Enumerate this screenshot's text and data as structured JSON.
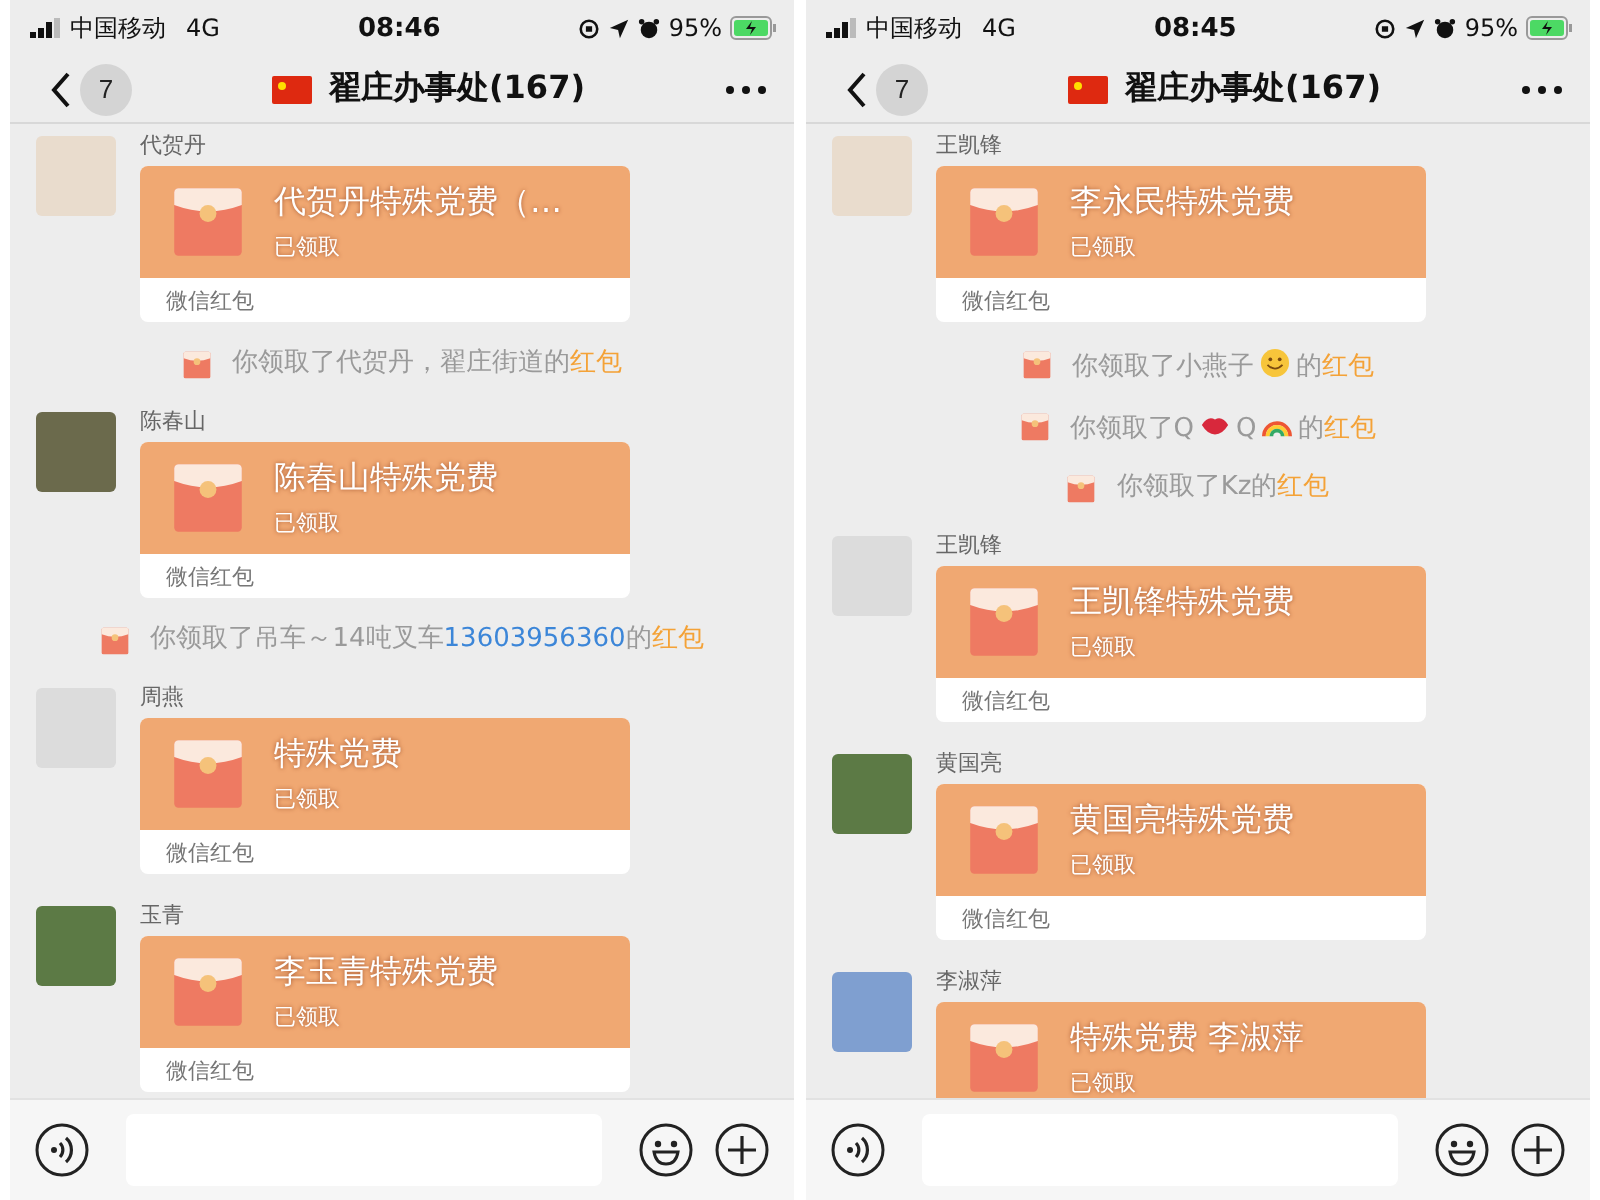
{
  "phones": [
    {
      "status_bar": {
        "carrier": "中国移动",
        "network": "4G",
        "time": "08:46",
        "battery": "95%"
      },
      "header": {
        "back_count": "7",
        "title": "翟庄办事处(167)"
      },
      "messages": [
        {
          "kind": "packet",
          "sender": "代贺丹",
          "title": "代贺丹特殊党费（…",
          "status": "已领取",
          "footer": "微信红包"
        },
        {
          "kind": "notice",
          "segments": [
            {
              "kind": "text",
              "text": "你领取了代贺丹，翟庄街道的"
            },
            {
              "kind": "packet_link",
              "text": "红包"
            }
          ]
        },
        {
          "kind": "packet",
          "sender": "陈春山",
          "title": "陈春山特殊党费",
          "status": "已领取",
          "footer": "微信红包"
        },
        {
          "kind": "notice",
          "segments": [
            {
              "kind": "text",
              "text": "你领取了吊车～14吨叉车"
            },
            {
              "kind": "phone_link",
              "text": "13603956360"
            },
            {
              "kind": "text",
              "text": "的"
            },
            {
              "kind": "packet_link",
              "text": "红包"
            }
          ]
        },
        {
          "kind": "packet",
          "sender": "周燕",
          "title": "特殊党费",
          "status": "已领取",
          "footer": "微信红包"
        },
        {
          "kind": "packet",
          "sender": "玉青",
          "title": "李玉青特殊党费",
          "status": "已领取",
          "footer": "微信红包"
        }
      ]
    },
    {
      "status_bar": {
        "carrier": "中国移动",
        "network": "4G",
        "time": "08:45",
        "battery": "95%"
      },
      "header": {
        "back_count": "7",
        "title": "翟庄办事处(167)"
      },
      "messages": [
        {
          "kind": "packet",
          "sender": "王凯锋",
          "title": "李永民特殊党费",
          "status": "已领取",
          "footer": "微信红包"
        },
        {
          "kind": "notice",
          "segments": [
            {
              "kind": "text",
              "text": "你领取了小燕子"
            },
            {
              "kind": "face"
            },
            {
              "kind": "text",
              "text": "的"
            },
            {
              "kind": "packet_link",
              "text": "红包"
            }
          ]
        },
        {
          "kind": "notice",
          "segments": [
            {
              "kind": "text",
              "text": "你领取了Q"
            },
            {
              "kind": "lips"
            },
            {
              "kind": "text",
              "text": "Q"
            },
            {
              "kind": "rainbow"
            },
            {
              "kind": "text",
              "text": "的"
            },
            {
              "kind": "packet_link",
              "text": "红包"
            }
          ]
        },
        {
          "kind": "notice",
          "segments": [
            {
              "kind": "text",
              "text": "你领取了Kz的"
            },
            {
              "kind": "packet_link",
              "text": "红包"
            }
          ]
        },
        {
          "kind": "packet",
          "sender": "王凯锋",
          "title": "王凯锋特殊党费",
          "status": "已领取",
          "footer": "微信红包"
        },
        {
          "kind": "packet",
          "sender": "黄国亮",
          "title": "黄国亮特殊党费",
          "status": "已领取",
          "footer": "微信红包"
        },
        {
          "kind": "packet",
          "sender": "李淑萍",
          "title": "特殊党费 李淑萍",
          "status": "已领取"
        }
      ]
    }
  ]
}
